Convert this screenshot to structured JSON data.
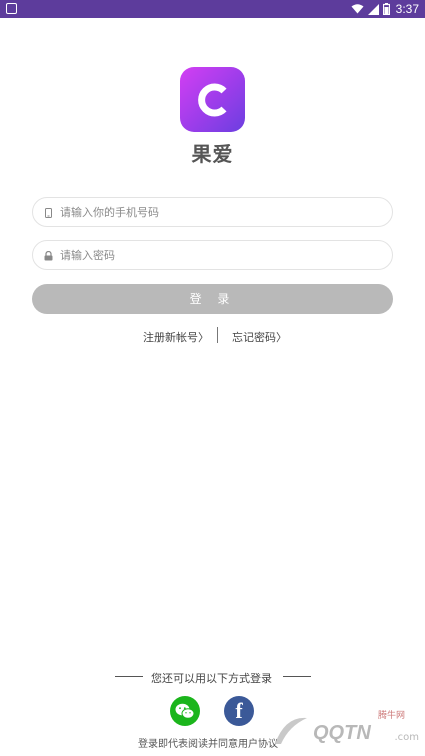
{
  "status_bar": {
    "time": "3:37",
    "bg_color": "#5d3c9c"
  },
  "app": {
    "name": "果爱",
    "logo_icon": "c-ring-logo"
  },
  "form": {
    "phone_placeholder": "请输入你的手机号码",
    "phone_value": "",
    "password_placeholder": "请输入密码",
    "password_value": "",
    "login_label": "登 录"
  },
  "links": {
    "register": "注册新帐号",
    "forgot": "忘记密码"
  },
  "alt_login": {
    "title": "您还可以用以下方式登录",
    "options": [
      "wechat-icon",
      "facebook-icon"
    ],
    "facebook_glyph": "f"
  },
  "agreement": "登录即代表阅读并同意用户协议",
  "watermark": {
    "brand": "QQTN",
    "small": "腾牛网",
    "suffix": ".com"
  },
  "colors": {
    "accent": "#9b3dea",
    "button_disabled": "#b9b9b9",
    "wechat": "#1bb51c",
    "facebook": "#3b5998"
  }
}
